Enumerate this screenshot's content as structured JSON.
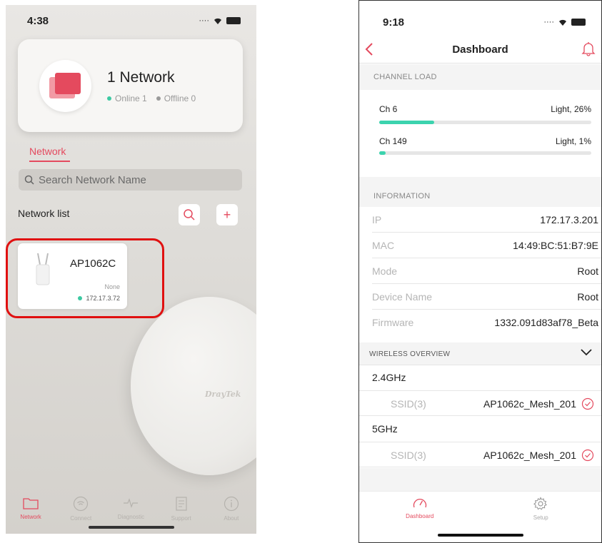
{
  "left_screen": {
    "status": {
      "time": "4:38"
    },
    "summary": {
      "title": "1 Network",
      "online": "Online 1",
      "offline": "Offline 0"
    },
    "tab": "Network",
    "search": {
      "placeholder": "Search Network Name"
    },
    "list_label": "Network list",
    "add_label": "+",
    "device": {
      "name": "AP1062C",
      "profile": "None",
      "ip": "172.17.3.72",
      "status_color": "#3cc9a2"
    },
    "brand_mark": "DrayTek",
    "tabbar": [
      {
        "label": "Network",
        "icon": "folder-icon",
        "active": true
      },
      {
        "label": "Connect",
        "icon": "wifi-icon",
        "active": false
      },
      {
        "label": "Diagnostic",
        "icon": "pulse-icon",
        "active": false
      },
      {
        "label": "Support",
        "icon": "document-icon",
        "active": false
      },
      {
        "label": "About",
        "icon": "info-icon",
        "active": false
      }
    ]
  },
  "right_screen": {
    "status": {
      "time": "9:18"
    },
    "nav": {
      "title": "Dashboard",
      "back": "<"
    },
    "channel_load": {
      "header": "CHANNEL LOAD",
      "channels": [
        {
          "name": "Ch 6",
          "status": "Light, 26%",
          "load_percent": 26
        },
        {
          "name": "Ch 149",
          "status": "Light, 1%",
          "load_percent": 1
        }
      ]
    },
    "information": {
      "header": "INFORMATION",
      "rows": [
        {
          "key": "IP",
          "value": "172.17.3.201"
        },
        {
          "key": "MAC",
          "value": "14:49:BC:51:B7:9E"
        },
        {
          "key": "Mode",
          "value": "Root"
        },
        {
          "key": "Device Name",
          "value": "Root"
        },
        {
          "key": "Firmware",
          "value": "1332.091d83af78_Beta"
        }
      ]
    },
    "wireless": {
      "header": "WIRELESS OVERVIEW",
      "bands": [
        {
          "band": "2.4GHz",
          "ssid_label": "SSID(3)",
          "ssid": "AP1062c_Mesh_201"
        },
        {
          "band": "5GHz",
          "ssid_label": "SSID(3)",
          "ssid": "AP1062c_Mesh_201"
        }
      ]
    },
    "tabbar": [
      {
        "label": "Dashboard",
        "icon": "gauge-icon",
        "active": true
      },
      {
        "label": "Setup",
        "icon": "gear-icon",
        "active": false
      }
    ]
  },
  "colors": {
    "accent": "#e44a5e",
    "online": "#3cc9a2",
    "bar": "#3cd3ae",
    "highlight": "#e01010"
  }
}
